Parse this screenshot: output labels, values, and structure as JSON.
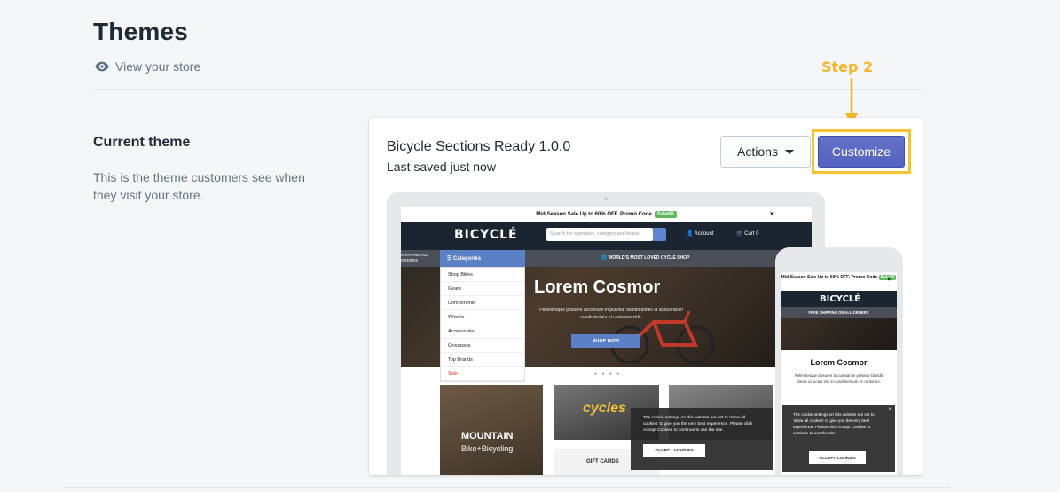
{
  "page": {
    "title": "Themes",
    "view_store_label": "View your store"
  },
  "current_theme": {
    "heading": "Current theme",
    "description": "This is the theme customers see when they visit your store."
  },
  "annotation": {
    "step_label": "Step 2",
    "color": "#f1b72a"
  },
  "theme_card": {
    "name": "Bicycle Sections Ready 1.0.0",
    "saved_status": "Last saved just now",
    "actions_label": "Actions",
    "customize_label": "Customize",
    "accent_color": "#5c6ac4"
  },
  "desktop_preview": {
    "promo_text": "Mid-Season Sale Up to 60% OFF. Promo Code",
    "promo_code": "Sale60",
    "logo": "BICYCLÉ",
    "search_placeholder": "Search for a product, category and brand",
    "account_label": "Account",
    "cart_label": "Cart",
    "cart_count": "0",
    "categories_label": "Categories",
    "shipping_note": "SHIPPING ALL ORDERS",
    "tagline": "WORLD'S MOST LOVED CYCLE SHOP",
    "hero_title": "Lorem Cosmor",
    "hero_subtitle": "Pellentesque posuere accumsan in pulvinar blandit donec id luctus nisi in condimentum et contoneo velit.",
    "shop_now_label": "SHOP NOW",
    "categories": [
      "Shop Bikes",
      "Gears",
      "Components",
      "Wheels",
      "Accessories",
      "Groupsets",
      "Top Brands",
      "Sale"
    ],
    "tile1_big": "MOUNTAIN",
    "tile1_small": "Bike+Bicycling",
    "tile2_text": "cycles",
    "tile4_text": "GIFT CARDS",
    "cookie_text": "The cookie settings on this website are set to 'allow all cookies' to give you the very best experience. Please click Accept Cookies to continue to use the site.",
    "accept_cookies_label": "ACCEPT COOKIES"
  },
  "mobile_preview": {
    "promo_text": "Mid-Season Sale Up to 60% OFF. Promo Code",
    "promo_code": "Sale60",
    "logo": "BICYCLÉ",
    "free_shipping": "FREE SHIPPING ON ALL ORDERS",
    "hero_title": "Lorem Cosmor",
    "hero_subtitle": "Pellentesque posuere accumsan in pulvinar blandit donec id luctus nisi in condimentum et contoneo.",
    "cookie_text": "The cookie settings on this website are set to 'allow all cookies' to give you the very best experience. Please click Accept Cookies to continue to use the site.",
    "accept_cookies_label": "ACCEPT COOKIES"
  }
}
